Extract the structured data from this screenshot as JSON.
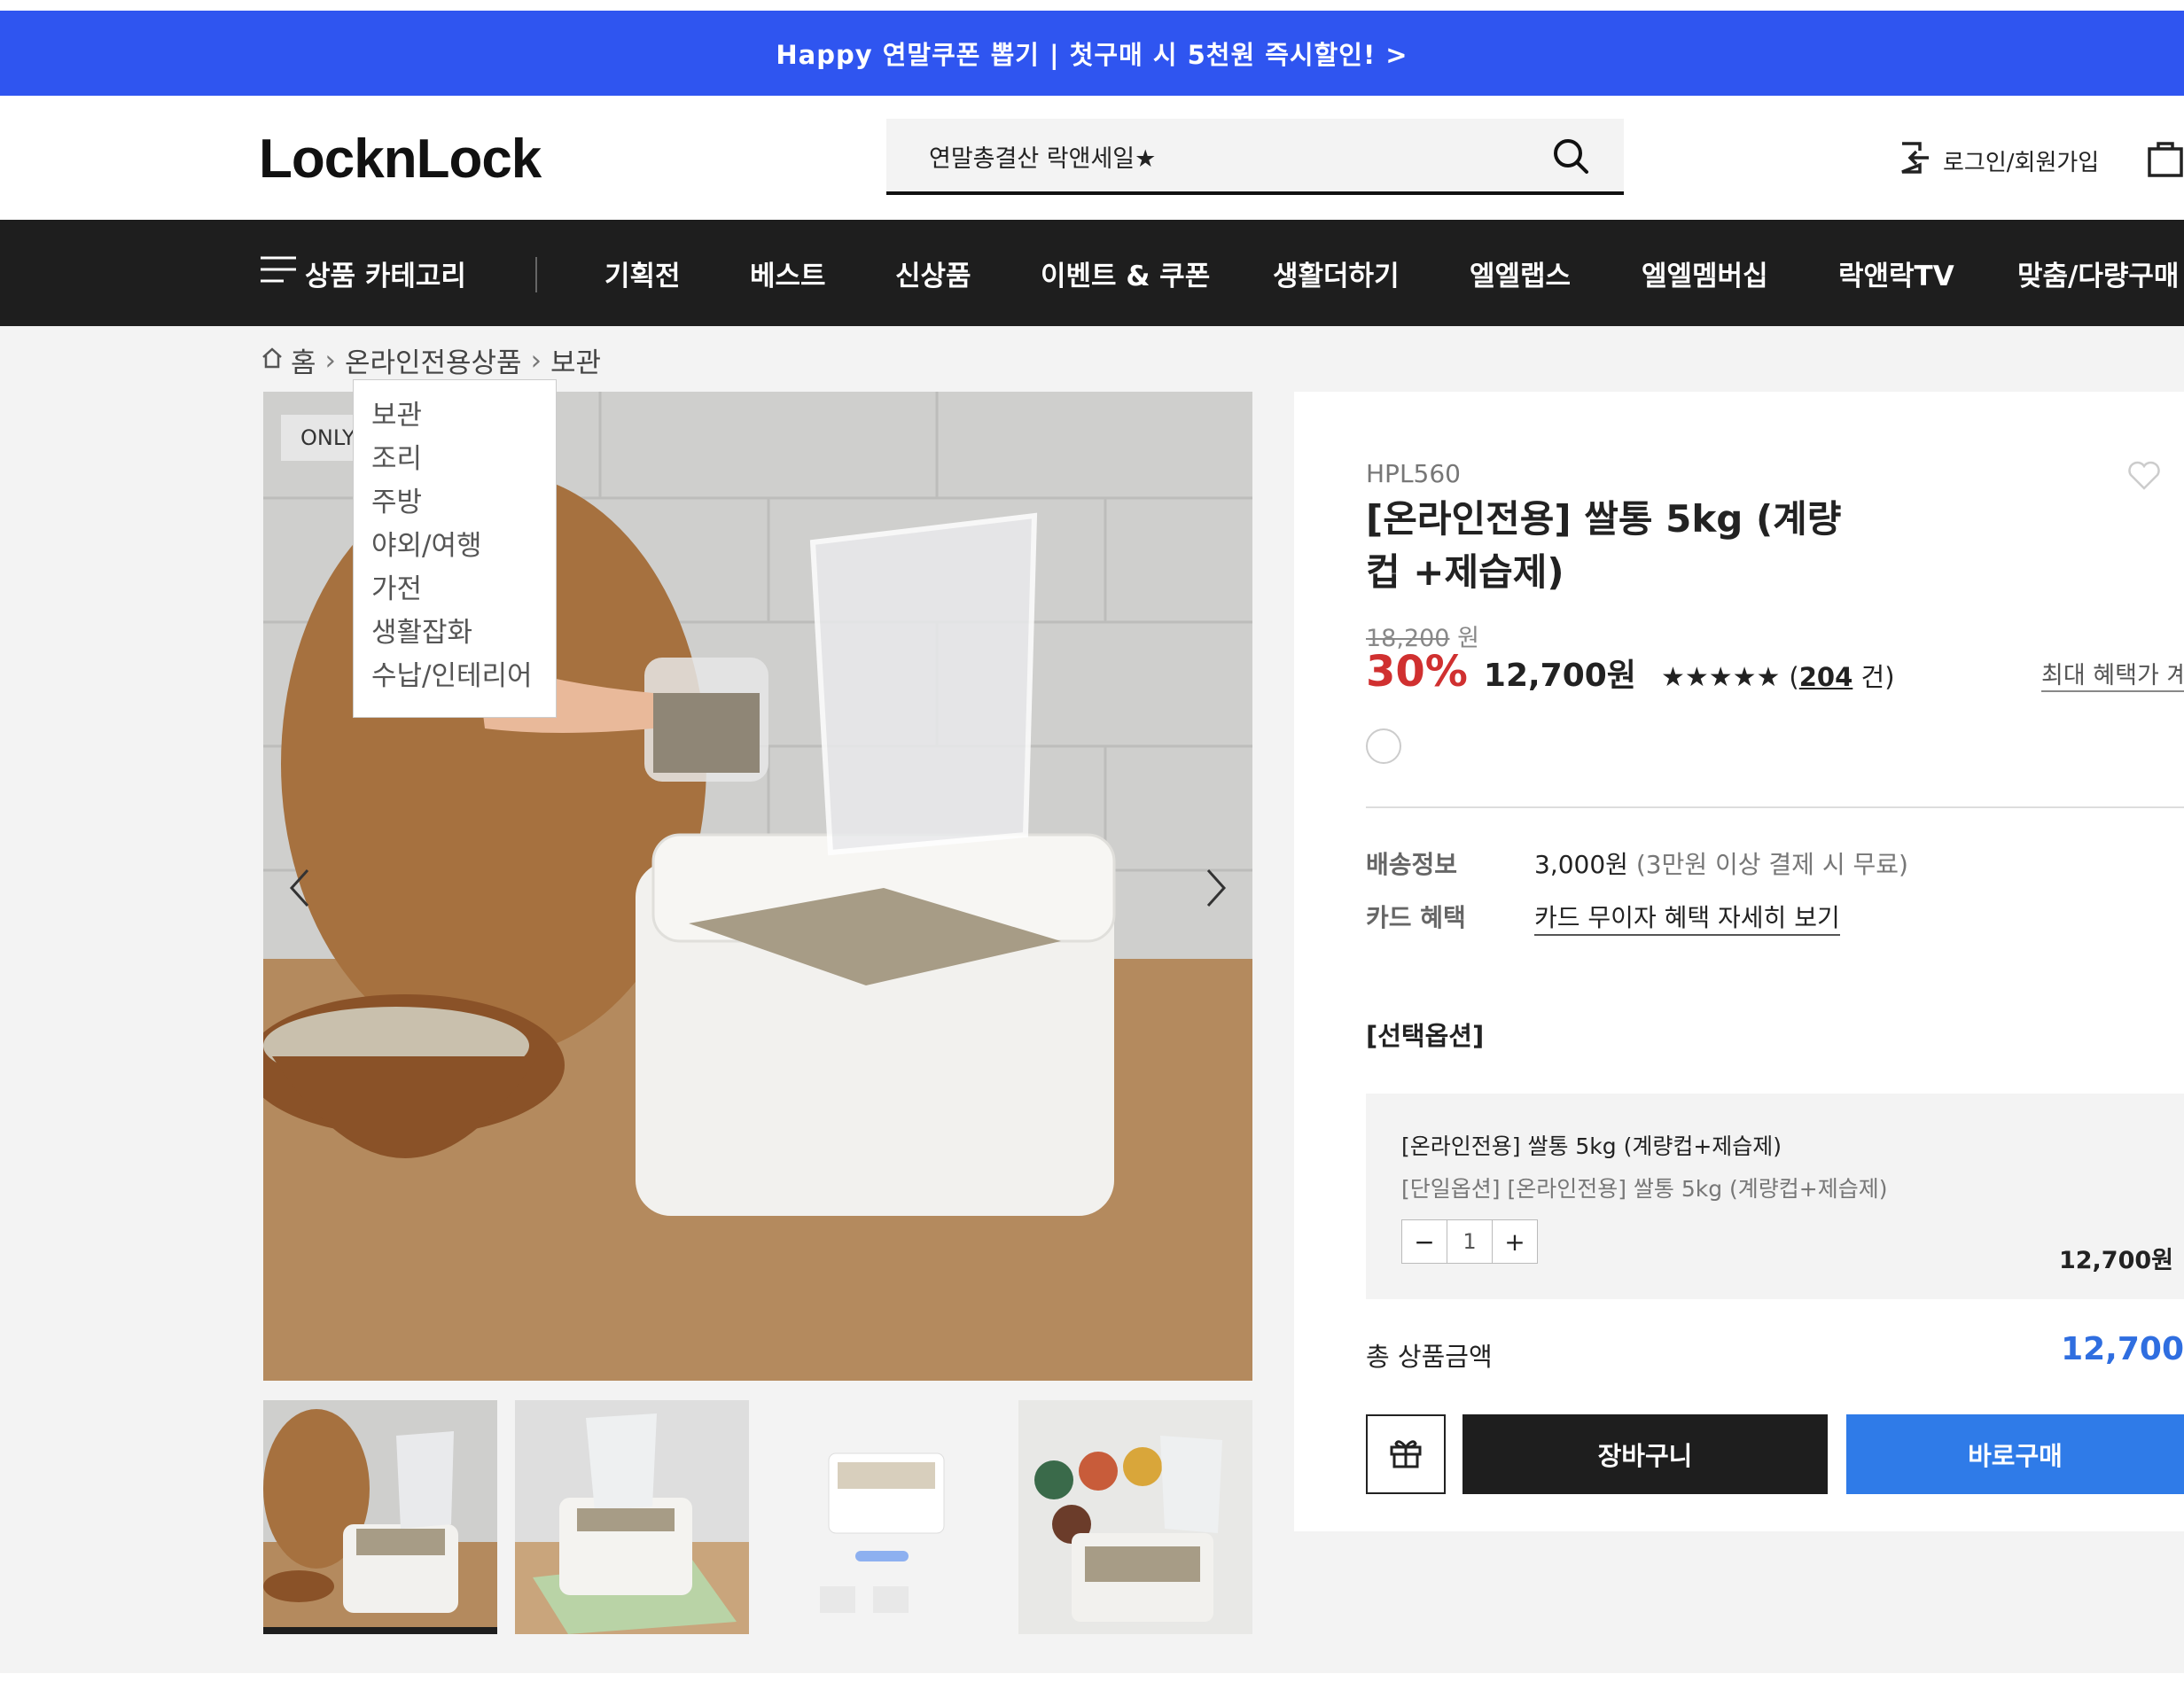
{
  "promo_banner": {
    "text": "Happy 연말쿠폰 뽑기 | 첫구매 시 5천원 즉시할인! >"
  },
  "header": {
    "logo": "LocknLock",
    "search_value": "연말총결산 락앤세일★",
    "login_label": "로그인/회원가입"
  },
  "gnb": {
    "category_label": "상품 카테고리",
    "items": [
      "기획전",
      "베스트",
      "신상품",
      "이벤트 & 쿠폰",
      "생활더하기",
      "엘엘랩스",
      "엘엘멤버십",
      "락앤락TV",
      "맞춤/다량구매"
    ]
  },
  "breadcrumb": {
    "home": "홈",
    "level1": "온라인전용상품",
    "level2": "보관"
  },
  "category_dropdown": [
    "보관",
    "조리",
    "주방",
    "야외/여행",
    "가전",
    "생활잡화",
    "수납/인테리어"
  ],
  "gallery": {
    "badge": "ONLY"
  },
  "product": {
    "code": "HPL560",
    "title": "[온라인전용] 쌀통 5kg (계량컵 +제습제)",
    "original_price": "18,200",
    "original_unit": "원",
    "discount": "30%",
    "price": "12,700원",
    "stars": "★★★★★",
    "review_prefix": "(",
    "review_count": "204",
    "review_suffix": " 건)",
    "benefit_link": "최대 혜택가 계"
  },
  "shipping": {
    "label": "배송정보",
    "value": "3,000원",
    "note": "(3만원 이상 결제 시 무료)",
    "card_label": "카드 혜택",
    "card_link": "카드 무이자 혜택 자세히 보기"
  },
  "option": {
    "section_label": "[선택옵션]",
    "name": "[온라인전용] 쌀통 5kg (계량컵+제습제)",
    "sub": "[단일옵션] [온라인전용] 쌀통 5kg (계량컵+제습제)",
    "minus": "−",
    "qty": "1",
    "plus": "+",
    "price": "12,700원"
  },
  "total": {
    "label": "총 상품금액",
    "value": "12,700"
  },
  "buttons": {
    "cart": "장바구니",
    "buy": "바로구매"
  },
  "colors": {
    "promo": "#2f55f0",
    "gnb": "#1e1e1e",
    "discount": "#d03030",
    "total": "#2f6ee0",
    "buy": "#2f7be8"
  }
}
